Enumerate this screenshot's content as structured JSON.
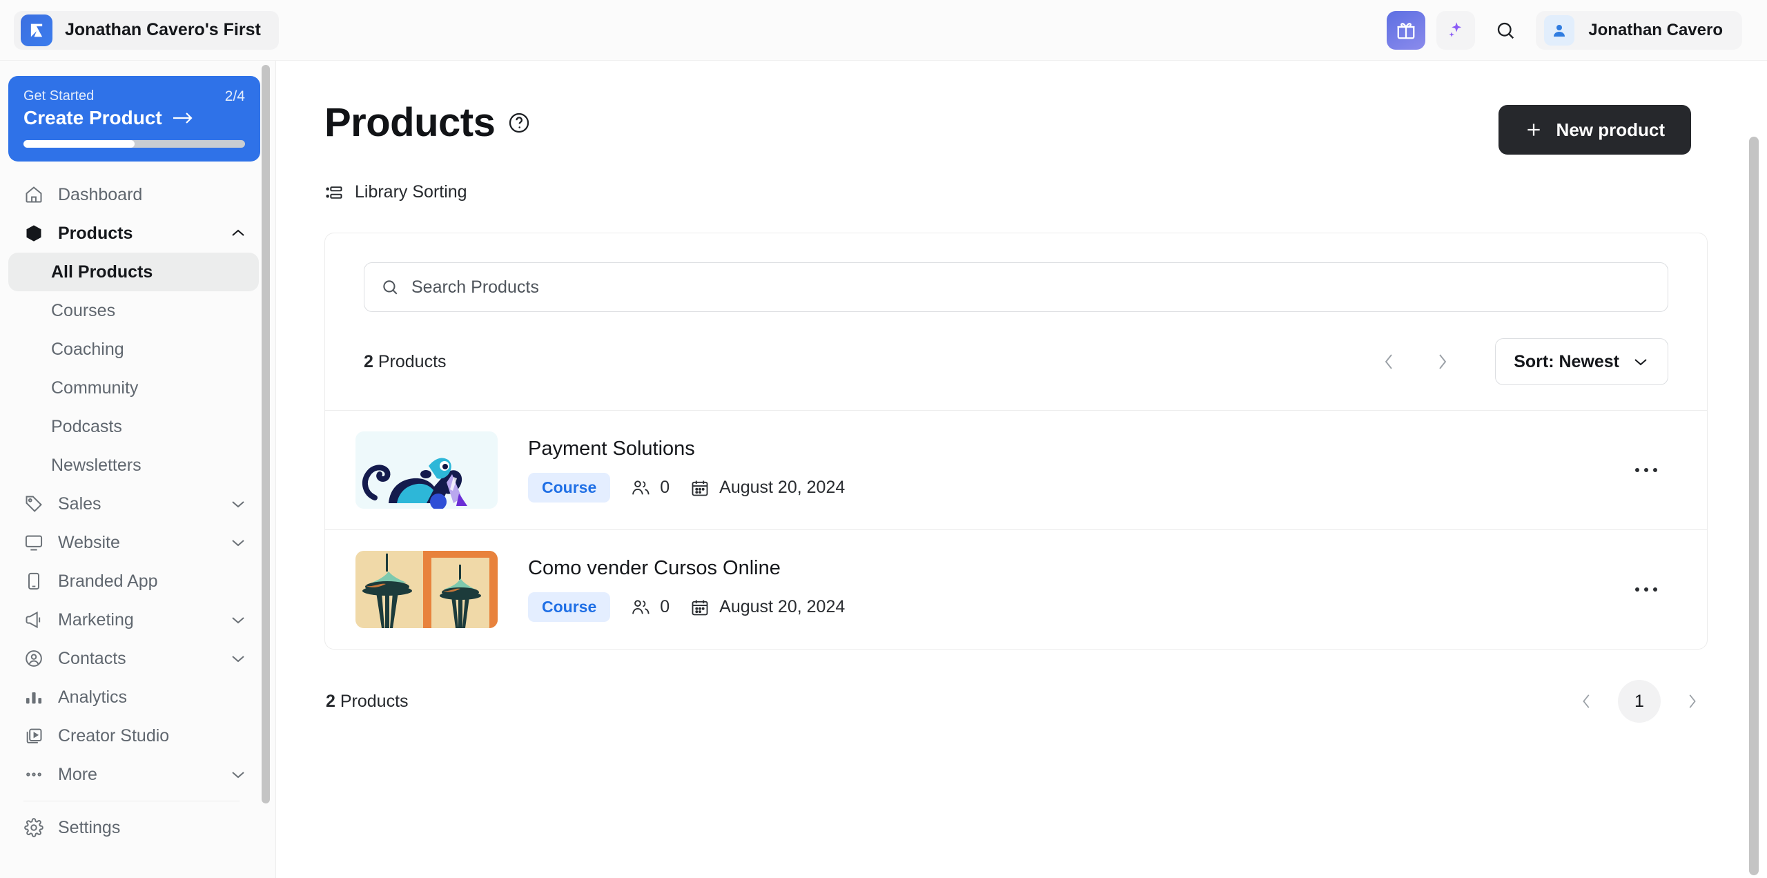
{
  "topbar": {
    "brand_name": "Jonathan Cavero's First",
    "logo_icon": "kajabi-logo-icon",
    "gift_icon": "gift-icon",
    "ai_icon": "sparkles-icon",
    "search_icon": "search-icon",
    "avatar_icon": "user-icon",
    "user_name": "Jonathan Cavero"
  },
  "sidebar": {
    "get_started": {
      "label": "Get Started",
      "count": "2/4",
      "title": "Create Product",
      "arrow_icon": "arrow-right-icon",
      "progress_percent": 50,
      "bg_color": "#2f72e8"
    },
    "items": [
      {
        "label": "Dashboard",
        "icon": "home-icon",
        "style": "muted",
        "chevron": ""
      },
      {
        "label": "Products",
        "icon": "cube-icon",
        "style": "bold",
        "chevron": "up"
      },
      {
        "label": "Sales",
        "icon": "tag-icon",
        "style": "muted",
        "chevron": "down"
      },
      {
        "label": "Website",
        "icon": "monitor-icon",
        "style": "muted",
        "chevron": "down"
      },
      {
        "label": "Branded App",
        "icon": "mobile-icon",
        "style": "muted",
        "chevron": ""
      },
      {
        "label": "Marketing",
        "icon": "megaphone-icon",
        "style": "muted",
        "chevron": "down"
      },
      {
        "label": "Contacts",
        "icon": "user-circle-icon",
        "style": "muted",
        "chevron": "down"
      },
      {
        "label": "Analytics",
        "icon": "bar-chart-icon",
        "style": "muted",
        "chevron": ""
      },
      {
        "label": "Creator Studio",
        "icon": "video-icon",
        "style": "muted",
        "chevron": ""
      },
      {
        "label": "More",
        "icon": "ellipsis-icon",
        "style": "muted",
        "chevron": "down"
      }
    ],
    "sub_items": [
      {
        "label": "All Products",
        "active": true
      },
      {
        "label": "Courses",
        "active": false
      },
      {
        "label": "Coaching",
        "active": false
      },
      {
        "label": "Community",
        "active": false
      },
      {
        "label": "Podcasts",
        "active": false
      },
      {
        "label": "Newsletters",
        "active": false
      }
    ],
    "settings": {
      "label": "Settings",
      "icon": "gear-icon"
    }
  },
  "main": {
    "page_title": "Products",
    "help_icon": "help-circle-icon",
    "new_product_label": "New product",
    "plus_icon": "plus-icon",
    "library_sorting_label": "Library Sorting",
    "library_sorting_icon": "list-icon",
    "search": {
      "placeholder": "Search Products",
      "value": "",
      "icon": "search-icon"
    },
    "toolbar": {
      "count_number": "2",
      "count_label": "Products",
      "prev_icon": "chevron-left-icon",
      "next_icon": "chevron-right-icon",
      "sort_label": "Sort: Newest",
      "sort_chevron": "chevron-down-icon"
    },
    "products": [
      {
        "title": "Payment Solutions",
        "badge": "Course",
        "members_icon": "users-icon",
        "members": "0",
        "date_icon": "calendar-icon",
        "date": "August 20, 2024",
        "menu_icon": "ellipsis-icon",
        "thumb": "dog-illustration"
      },
      {
        "title": "Como vender Cursos Online",
        "badge": "Course",
        "members_icon": "users-icon",
        "members": "0",
        "date_icon": "calendar-icon",
        "date": "August 20, 2024",
        "menu_icon": "ellipsis-icon",
        "thumb": "space-needle-illustration"
      }
    ],
    "footer": {
      "count_number": "2",
      "count_label": "Products",
      "prev_icon": "chevron-left-icon",
      "page_number": "1",
      "next_icon": "chevron-right-icon"
    }
  },
  "colors": {
    "accent_blue": "#2f72e8",
    "badge_blue": "#1f6fe5",
    "badge_bg": "#e4eeff",
    "dark_button": "#26282c"
  }
}
